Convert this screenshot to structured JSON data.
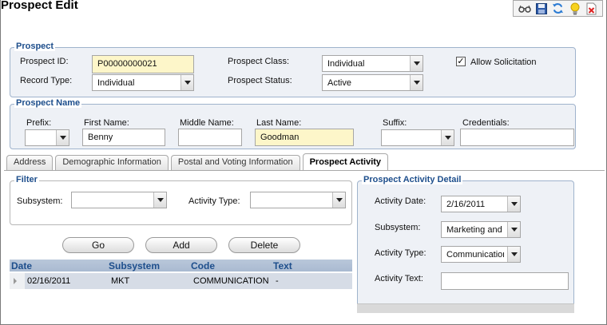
{
  "page": {
    "title": "Prospect Edit"
  },
  "toolbar": {
    "icons": [
      "glasses-icon",
      "save-icon",
      "refresh-icon",
      "lightbulb-icon",
      "delete-icon"
    ]
  },
  "prospect": {
    "legend": "Prospect",
    "id_label": "Prospect ID:",
    "id_value": "P00000000021",
    "record_type_label": "Record Type:",
    "record_type_value": "Individual",
    "class_label": "Prospect Class:",
    "class_value": "Individual",
    "status_label": "Prospect Status:",
    "status_value": "Active",
    "allow_solicitation_label": "Allow Solicitation",
    "allow_solicitation_checked": true
  },
  "name": {
    "legend": "Prospect Name",
    "prefix_label": "Prefix:",
    "prefix_value": "",
    "first_label": "First Name:",
    "first_value": "Benny",
    "middle_label": "Middle Name:",
    "middle_value": "",
    "last_label": "Last Name:",
    "last_value": "Goodman",
    "suffix_label": "Suffix:",
    "suffix_value": "",
    "credentials_label": "Credentials:",
    "credentials_value": ""
  },
  "tabs": [
    {
      "label": "Address",
      "active": false
    },
    {
      "label": "Demographic Information",
      "active": false
    },
    {
      "label": "Postal and Voting Information",
      "active": false
    },
    {
      "label": "Prospect Activity",
      "active": true
    }
  ],
  "filter": {
    "legend": "Filter",
    "subsystem_label": "Subsystem:",
    "subsystem_value": "",
    "activity_type_label": "Activity Type:",
    "activity_type_value": ""
  },
  "buttons": {
    "go": "Go",
    "add": "Add",
    "delete": "Delete"
  },
  "grid": {
    "columns": [
      "Date",
      "Subsystem",
      "Code",
      "Text"
    ],
    "rows": [
      {
        "date": "02/16/2011",
        "subsystem": "MKT",
        "code": "COMMUNICATION",
        "text": "-"
      }
    ]
  },
  "detail": {
    "legend": "Prospect Activity Detail",
    "date_label": "Activity Date:",
    "date_value": "2/16/2011",
    "subsystem_label": "Subsystem:",
    "subsystem_value": "Marketing and",
    "type_label": "Activity Type:",
    "type_value": "Communication",
    "text_label": "Activity Text:",
    "text_value": ""
  }
}
